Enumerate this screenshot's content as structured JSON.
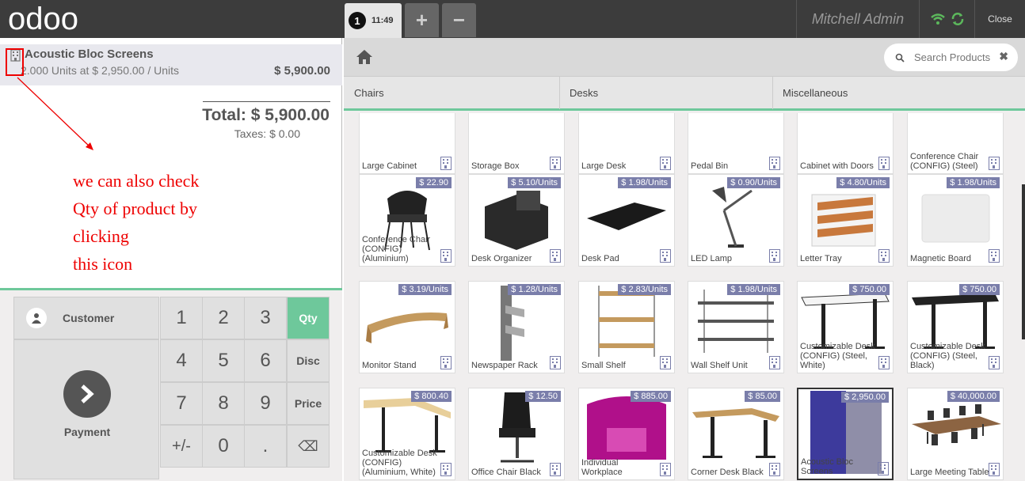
{
  "topbar": {
    "logo": "odoo",
    "order_number": "1",
    "order_time": "11:49",
    "add_label": "+",
    "remove_label": "−",
    "user": "Mitchell Admin",
    "close": "Close"
  },
  "orderline": {
    "name": "Acoustic Bloc Screens",
    "info": "2.000 Units at $ 2,950.00 / Units",
    "price": "$ 5,900.00"
  },
  "summary": {
    "total": "Total: $ 5,900.00",
    "taxes": "Taxes: $ 0.00"
  },
  "annotation": {
    "lines": [
      "we can also check",
      "Qty of product by",
      "clicking",
      "this icon"
    ]
  },
  "pad": {
    "customer": "Customer",
    "payment": "Payment",
    "keys": [
      "1",
      "2",
      "3",
      "Qty",
      "4",
      "5",
      "6",
      "Disc",
      "7",
      "8",
      "9",
      "Price",
      "+/-",
      "0",
      ".",
      "⌫"
    ]
  },
  "search": {
    "placeholder": "Search Products"
  },
  "categories": [
    "Chairs",
    "Desks",
    "Miscellaneous"
  ],
  "products": [
    {
      "name": "Large Cabinet",
      "price": ""
    },
    {
      "name": "Storage Box",
      "price": ""
    },
    {
      "name": "Large Desk",
      "price": ""
    },
    {
      "name": "Pedal Bin",
      "price": ""
    },
    {
      "name": "Cabinet with Doors",
      "price": ""
    },
    {
      "name": "Conference Chair (CONFIG) (Steel)",
      "price": ""
    },
    {
      "name": "Conference Chair (CONFIG) (Aluminium)",
      "price": "$ 22.90"
    },
    {
      "name": "Desk Organizer",
      "price": "$ 5.10/Units"
    },
    {
      "name": "Desk Pad",
      "price": "$ 1.98/Units"
    },
    {
      "name": "LED Lamp",
      "price": "$ 0.90/Units"
    },
    {
      "name": "Letter Tray",
      "price": "$ 4.80/Units"
    },
    {
      "name": "Magnetic Board",
      "price": "$ 1.98/Units"
    },
    {
      "name": "Monitor Stand",
      "price": "$ 3.19/Units"
    },
    {
      "name": "Newspaper Rack",
      "price": "$ 1.28/Units"
    },
    {
      "name": "Small Shelf",
      "price": "$ 2.83/Units"
    },
    {
      "name": "Wall Shelf Unit",
      "price": "$ 1.98/Units"
    },
    {
      "name": "Customizable Desk (CONFIG) (Steel, White)",
      "price": "$ 750.00"
    },
    {
      "name": "Customizable Desk (CONFIG) (Steel, Black)",
      "price": "$ 750.00"
    },
    {
      "name": "Customizable Desk (CONFIG) (Aluminium, White)",
      "price": "$ 800.40"
    },
    {
      "name": "Office Chair Black",
      "price": "$ 12.50"
    },
    {
      "name": "Individual Workplace",
      "price": "$ 885.00"
    },
    {
      "name": "Corner Desk Black",
      "price": "$ 85.00"
    },
    {
      "name": "Acoustic Bloc Screens",
      "price": "$ 2,950.00"
    },
    {
      "name": "Large Meeting Table",
      "price": "$ 40,000.00"
    }
  ],
  "colors": {
    "accent": "#6ec89b",
    "price_badge": "#7a7eaa",
    "annotation": "#e00000"
  }
}
